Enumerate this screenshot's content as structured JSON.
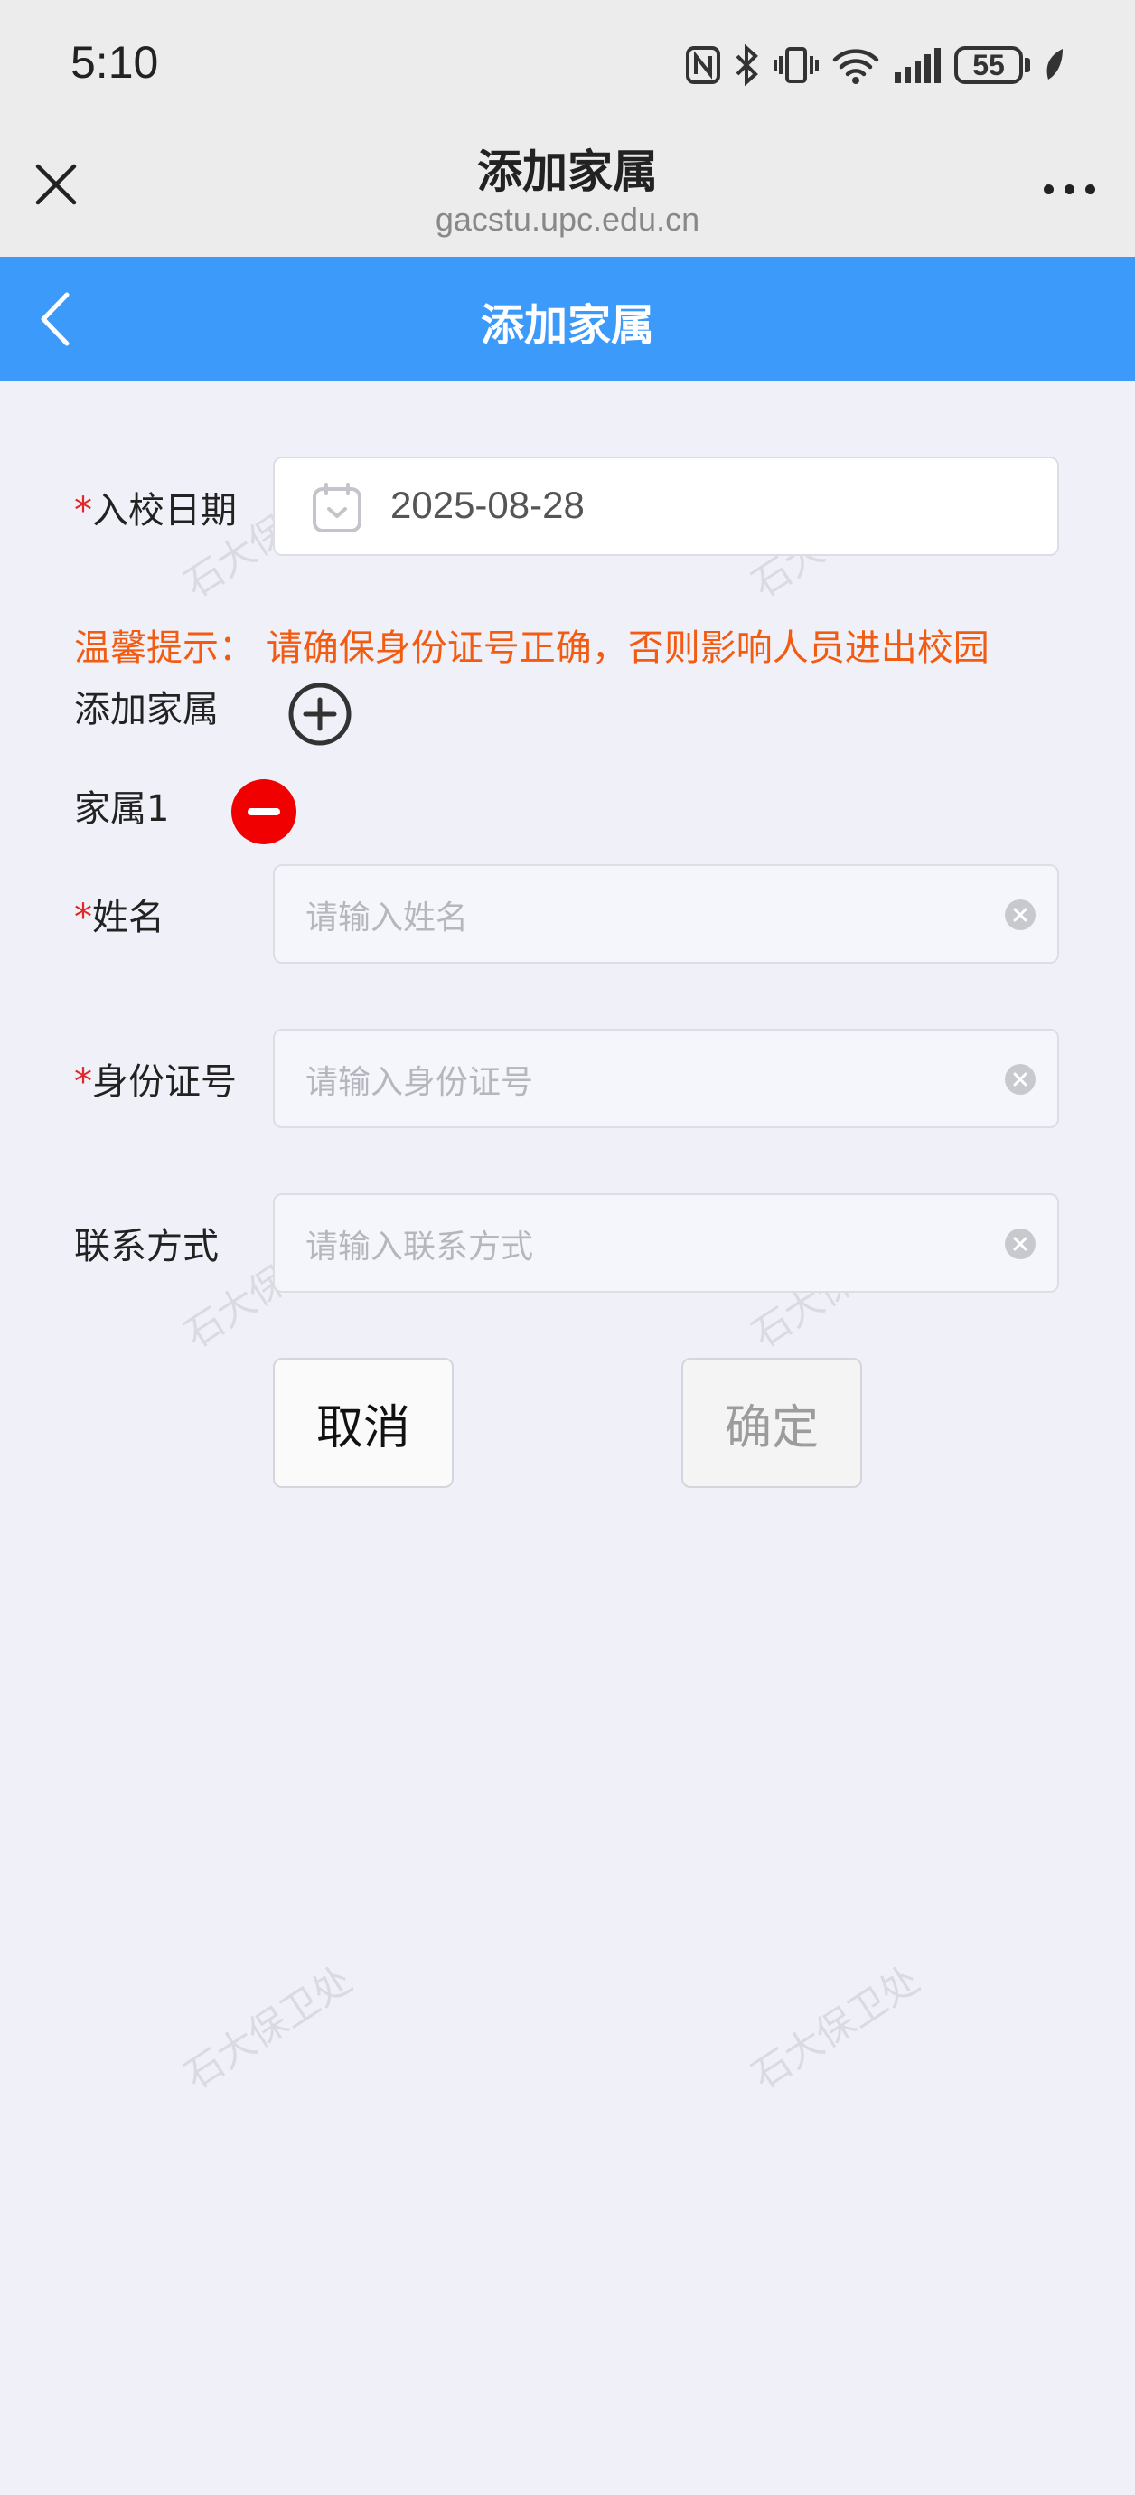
{
  "status_bar": {
    "time": "5:10",
    "battery": "55"
  },
  "browser": {
    "title": "添加家属",
    "domain": "gacstu.upc.edu.cn"
  },
  "nav": {
    "title": "添加家属"
  },
  "form": {
    "date_label": "入校日期",
    "date_value": "2025-08-28",
    "tip": "温馨提示：  请确保身份证号正确，否则影响人员进出校园",
    "add_family_label": "添加家属",
    "member_label": "家属1",
    "name_label": "姓名",
    "name_placeholder": "请输入姓名",
    "id_label": "身份证号",
    "id_placeholder": "请输入身份证号",
    "contact_label": "联系方式",
    "contact_placeholder": "请输入联系方式",
    "required_mark": "*"
  },
  "actions": {
    "cancel": "取消",
    "confirm": "确定"
  },
  "watermark": "石大保卫处",
  "colors": {
    "nav_bg": "#3c9afb",
    "tip": "#f25b12",
    "required": "#e02828",
    "remove": "#f00000"
  }
}
